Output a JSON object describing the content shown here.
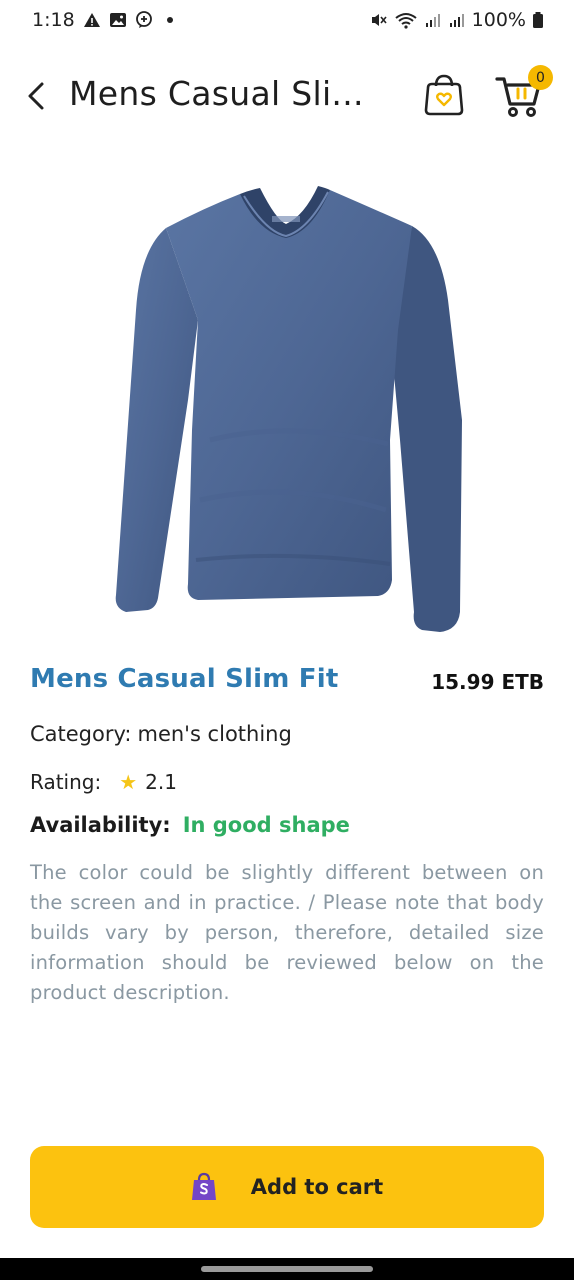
{
  "status_bar": {
    "time": "1:18",
    "battery": "100%",
    "icons_left": [
      "alert-icon",
      "image-icon",
      "chat-plus-icon",
      "dot-icon"
    ],
    "icons_right": [
      "mute-icon",
      "wifi-icon",
      "signal-icon",
      "signal-icon",
      "battery-icon"
    ]
  },
  "app_bar": {
    "title": "Mens Casual Sli...",
    "cart_count": "0"
  },
  "product": {
    "image_icon": "long-sleeve-shirt",
    "name": "Mens Casual Slim Fit",
    "price": "15.99 ETB",
    "category_label": "Category:",
    "category_value": "men's clothing",
    "rating_label": "Rating:",
    "rating_value": "2.1",
    "availability_label": "Availability:",
    "availability_value": "In good shape",
    "description": "The color could be slightly different between on the screen and in practice. / Please note that body builds vary by person, therefore, detailed size information should be reviewed below on the product description."
  },
  "actions": {
    "add_to_cart": "Add to cart"
  },
  "colors": {
    "accent": "#fcc20f",
    "title_blue": "#2f7bb1",
    "availability_green": "#2fae62",
    "description_gray": "#8a98a2"
  }
}
